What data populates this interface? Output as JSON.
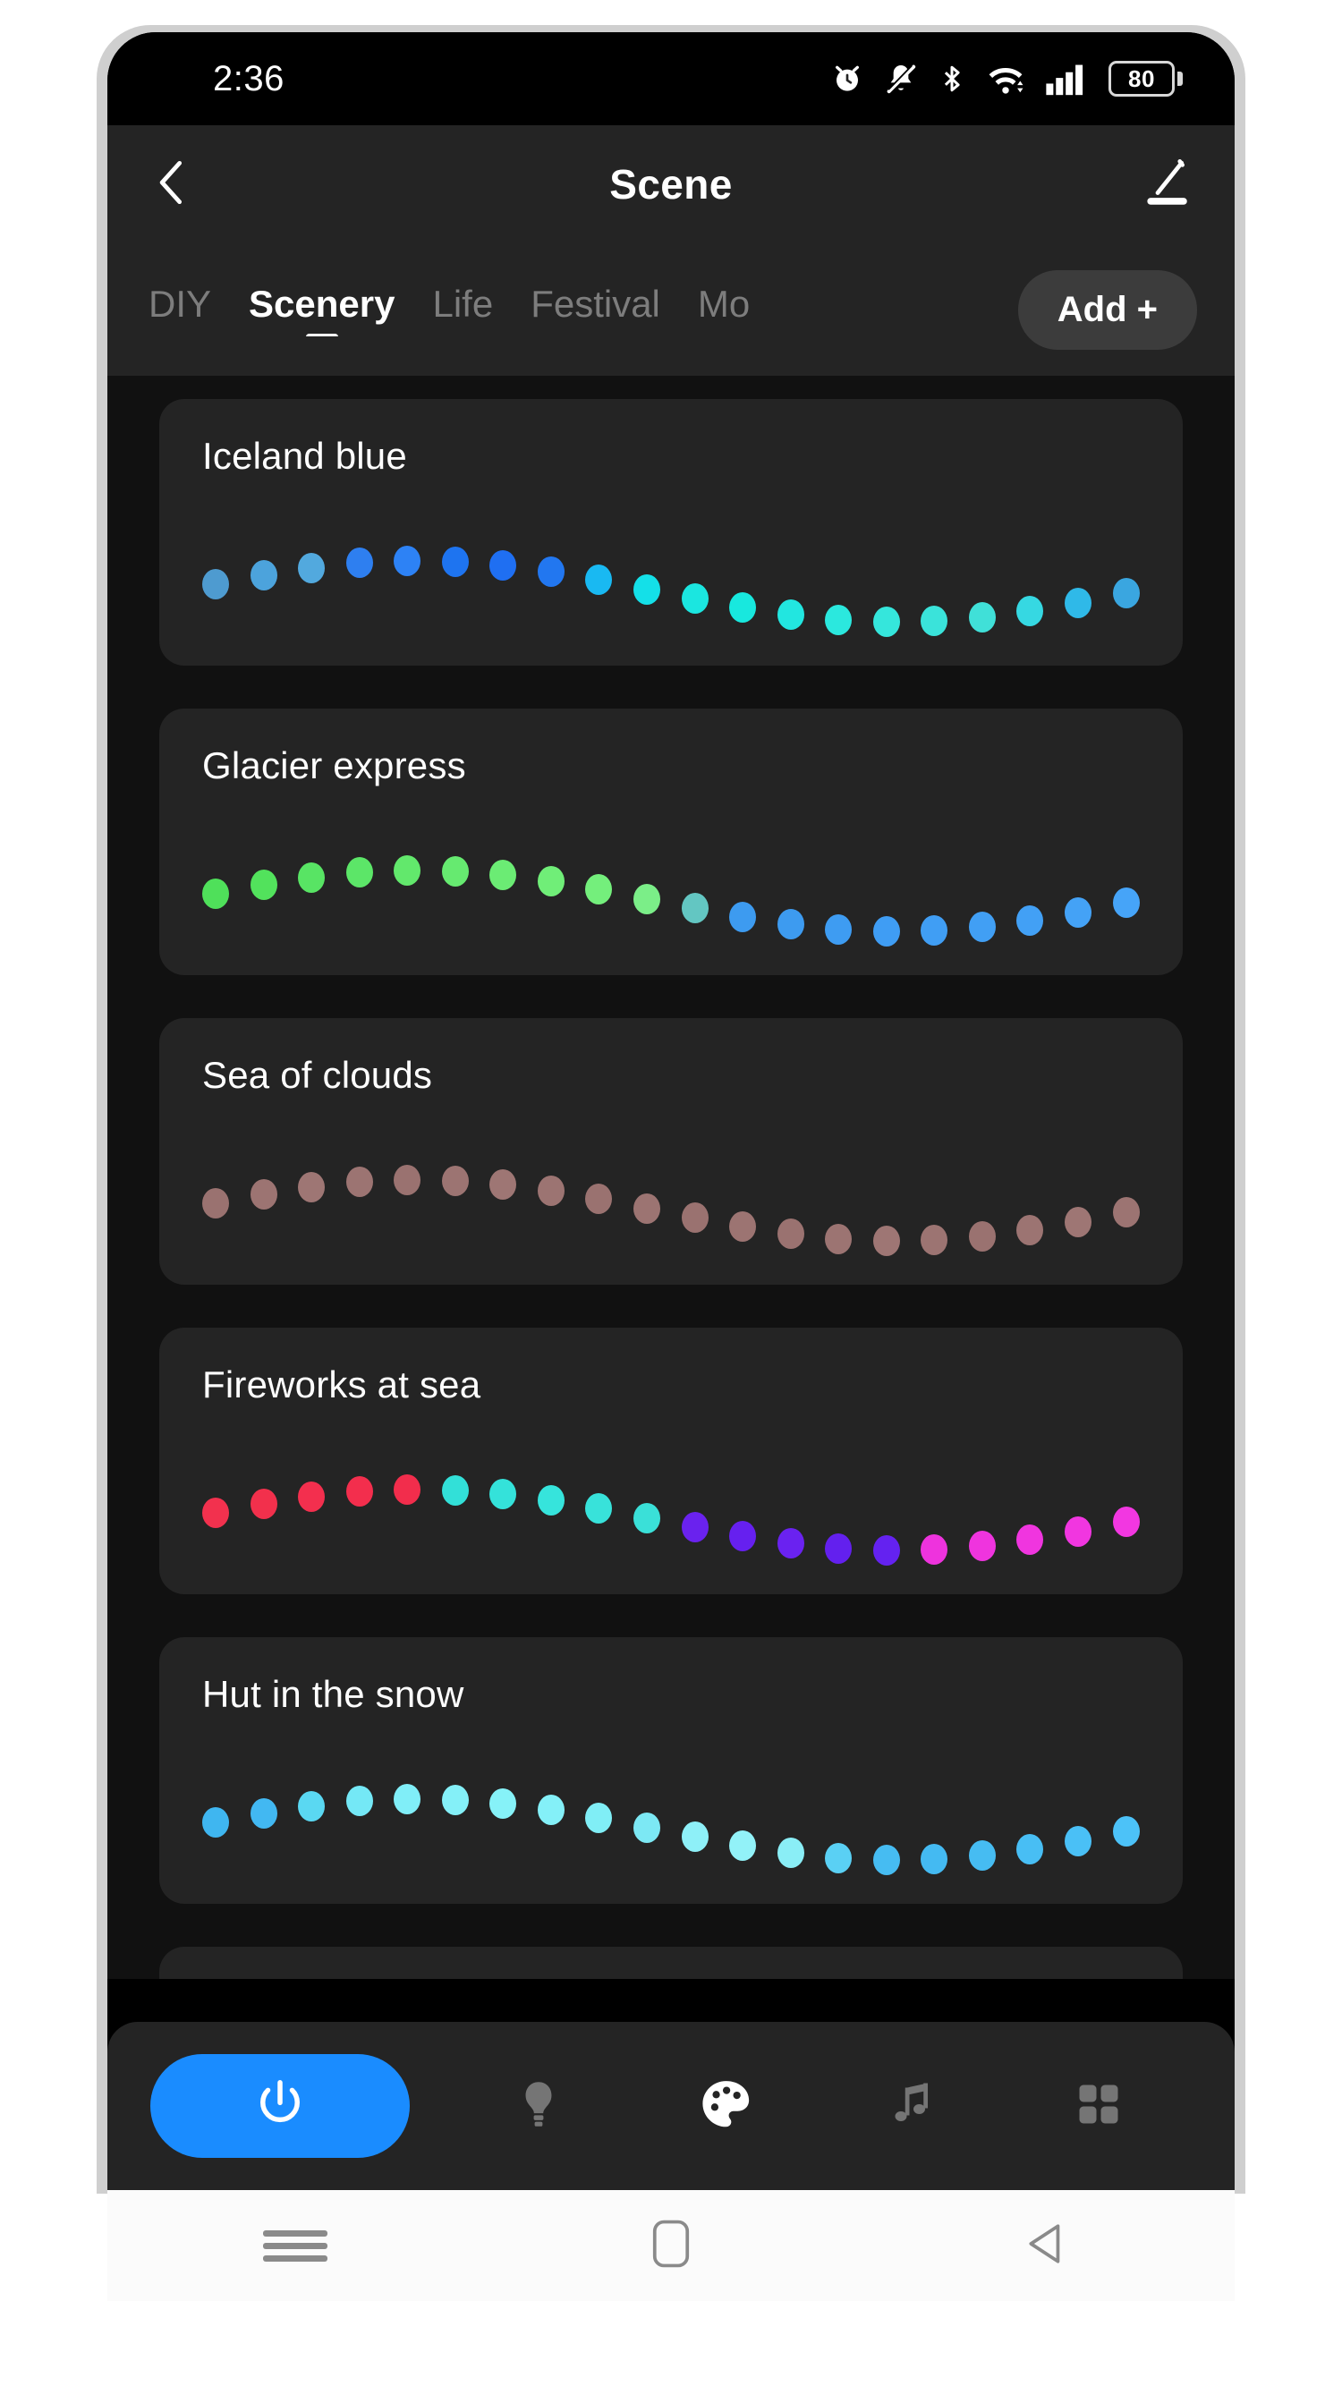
{
  "status_bar": {
    "time": "2:36",
    "battery_level": "80",
    "icons": [
      "alarm-icon",
      "bell-muted-icon",
      "bluetooth-icon",
      "wifi-icon",
      "signal-icon",
      "battery-icon"
    ]
  },
  "header": {
    "title": "Scene",
    "back_icon": "chevron-left-icon",
    "edit_icon": "pencil-icon"
  },
  "tabs": {
    "items": [
      {
        "label": "DIY",
        "active": false
      },
      {
        "label": "Scenery",
        "active": true
      },
      {
        "label": "Life",
        "active": false
      },
      {
        "label": "Festival",
        "active": false
      },
      {
        "label": "Mo",
        "active": false
      }
    ],
    "add_label": "Add +"
  },
  "scenes": [
    {
      "name": "Iceland blue",
      "dots": [
        "#4E9BD0",
        "#4CA3DC",
        "#52A9DE",
        "#2E7FF0",
        "#2D82F5",
        "#1E74F0",
        "#1F6FF2",
        "#2277F0",
        "#19B9F2",
        "#14E0E8",
        "#1BE6E0",
        "#18E8DE",
        "#22E6E0",
        "#2BE8DE",
        "#35E6DC",
        "#3AE3DA",
        "#40E0D8",
        "#36D8E2",
        "#2FB9E8",
        "#3AA6E0"
      ]
    },
    {
      "name": "Glacier express",
      "dots": [
        "#4FE05A",
        "#52E25C",
        "#58E464",
        "#5CE668",
        "#62E86C",
        "#66EA70",
        "#6BEC74",
        "#70EE78",
        "#74EF7C",
        "#7BEE88",
        "#63C6C2",
        "#3D9BF0",
        "#3D9BF0",
        "#3E9CF2",
        "#3F9DF4",
        "#409EF4",
        "#419FF4",
        "#42A0F5",
        "#44A2F6",
        "#46A4F8"
      ]
    },
    {
      "name": "Sea of clouds",
      "dots": [
        "#9A7270",
        "#9C7472",
        "#9E7674",
        "#9C7472",
        "#9A7270",
        "#9C7472",
        "#9E7674",
        "#9C7472",
        "#9A7270",
        "#9C7472",
        "#9A7270",
        "#9C7472",
        "#9A7270",
        "#9C7472",
        "#9E7674",
        "#9C7472",
        "#9A7270",
        "#9C7472",
        "#9E7674",
        "#9C7472"
      ]
    },
    {
      "name": "Fireworks at sea",
      "dots": [
        "#F2314E",
        "#F2304C",
        "#F32F4E",
        "#F32E4D",
        "#F22D4C",
        "#32E0D8",
        "#34E2DA",
        "#36E4DC",
        "#38E2DA",
        "#3AE0D8",
        "#6A22EE",
        "#6620EF",
        "#6A22F0",
        "#6320EE",
        "#6422F0",
        "#EE33DD",
        "#EF34DE",
        "#F035DF",
        "#F136E0",
        "#F237E1"
      ]
    },
    {
      "name": "Hut in the snow",
      "dots": [
        "#3FB6F0",
        "#42B8F2",
        "#5AD8F2",
        "#74E8F6",
        "#80EEF8",
        "#84F0F8",
        "#86F2F8",
        "#84F0F8",
        "#80EEF6",
        "#7CE8F4",
        "#8EF0F8",
        "#92F2F8",
        "#8AEEF6",
        "#5AD0F4",
        "#46BCF2",
        "#44BAF2",
        "#46BCF2",
        "#48BEF4",
        "#4AC0F6",
        "#4CC2F8"
      ]
    }
  ],
  "bottom_bar": {
    "items": [
      {
        "name": "power-button",
        "icon": "power-icon",
        "active": true
      },
      {
        "name": "bulb-button",
        "icon": "bulb-icon",
        "active": false
      },
      {
        "name": "palette-button",
        "icon": "palette-icon",
        "active": true
      },
      {
        "name": "music-button",
        "icon": "music-note-icon",
        "active": false
      },
      {
        "name": "grid-button",
        "icon": "grid-icon",
        "active": false
      }
    ]
  },
  "android_nav": {
    "recents_icon": "menu-icon",
    "home_icon": "home-square-icon",
    "back_icon": "back-triangle-icon"
  },
  "colors": {
    "page_bg": "#111111",
    "card_bg": "#242424",
    "accent": "#1a8cff",
    "header_bg": "#242424"
  }
}
